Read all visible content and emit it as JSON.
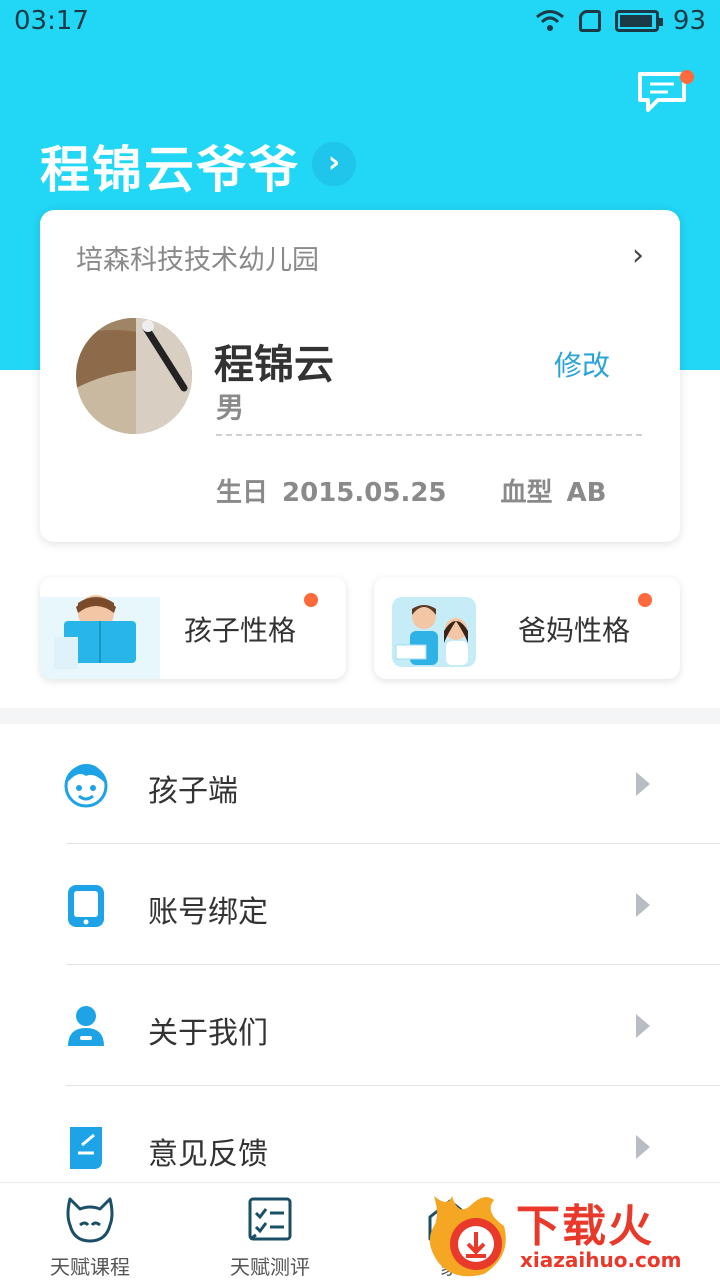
{
  "status_bar": {
    "time": "03:17",
    "battery": "93"
  },
  "header": {
    "user_title": "程锦云爷爷",
    "arrow": "›"
  },
  "profile": {
    "school": "培森科技技术幼儿园",
    "school_arrow": "›",
    "name": "程锦云",
    "gender": "男",
    "edit_label": "修改",
    "birthday_label": "生日",
    "birthday_value": "2015.05.25",
    "blood_label": "血型",
    "blood_value": "AB"
  },
  "traits": [
    {
      "label": "孩子性格"
    },
    {
      "label": "爸妈性格"
    }
  ],
  "menu": [
    {
      "label": "孩子端",
      "icon": "child-face-icon"
    },
    {
      "label": "账号绑定",
      "icon": "phone-icon"
    },
    {
      "label": "关于我们",
      "icon": "person-icon"
    },
    {
      "label": "意见反馈",
      "icon": "feedback-icon"
    }
  ],
  "tabs": [
    {
      "label": "天赋课程",
      "icon": "cat-face-icon"
    },
    {
      "label": "天赋测评",
      "icon": "checklist-icon"
    },
    {
      "label": "家",
      "icon": "house-icon"
    }
  ],
  "watermark": {
    "text": "下载火",
    "url": "xiazaihuo.com"
  },
  "colors": {
    "header": "#22d6f5",
    "accent": "#2aa4d8",
    "badge": "#ff6a3d"
  }
}
